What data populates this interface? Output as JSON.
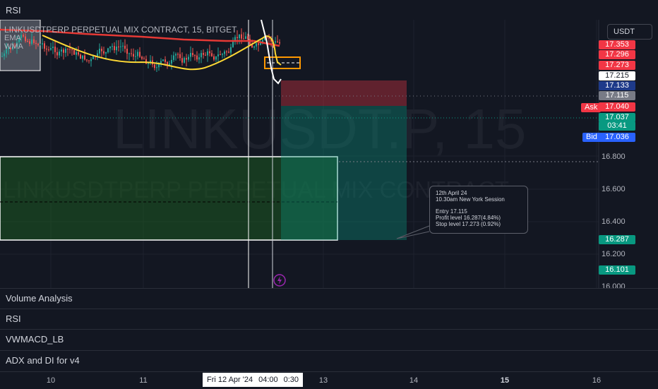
{
  "top_pane": {
    "title": "RSI"
  },
  "chart": {
    "symbol_line": "LINKUSDTPERP PERPETUAL MIX CONTRACT, 15, BITGET",
    "indicators": [
      "EMA",
      "WMA"
    ],
    "watermark_symbol": "LINKUSDT.P, 15",
    "watermark_desc": "LINKUSDTPERP PERPETUAL MIX CONTRACT",
    "currency_button": "USDT",
    "price_labels": [
      {
        "value": "17.353",
        "color": "#f23645"
      },
      {
        "value": "17.296",
        "color": "#f23645"
      },
      {
        "value": "17.273",
        "color": "#f23645"
      },
      {
        "value": "17.215",
        "color": "#ffffff"
      },
      {
        "value": "17.133",
        "color": "#1e3a8a"
      },
      {
        "value": "17.115",
        "color": "#787b86"
      },
      {
        "value": "17.040",
        "color": "#f23645"
      },
      {
        "value": "17.037",
        "color": "#089981"
      },
      {
        "value": "03:41",
        "color": "#089981"
      },
      {
        "value": "17.036",
        "color": "#2962ff"
      },
      {
        "value": "16.287",
        "color": "#089981"
      },
      {
        "value": "16.101",
        "color": "#089981"
      }
    ],
    "ask_label": "Ask",
    "bid_label": "Bid",
    "axis_prices": [
      "16.800",
      "16.600",
      "16.400",
      "16.200",
      "16.000"
    ],
    "note": {
      "line1": "12th April 24",
      "line2": "10.30am  New York Session",
      "line3": "Entry 17.115",
      "line4": "Profit level 16.287(4.84%)",
      "line5": "Stop level 17.273 (0.92%)"
    },
    "colors": {
      "bg": "#131722",
      "up": "#26a69a",
      "down": "#ef5350",
      "ema": "#e53935",
      "wma": "#fdd835"
    }
  },
  "panes": [
    "Volume Analysis",
    "RSI",
    "VWMACD_LB",
    "ADX and DI for v4"
  ],
  "time_axis": {
    "ticks": [
      "10",
      "11",
      "13",
      "14",
      "15",
      "16"
    ],
    "current_date": "Fri 12 Apr '24",
    "current_time": "04:00",
    "countdown": "0:30"
  },
  "icons": {
    "alert": "lightning-icon"
  }
}
